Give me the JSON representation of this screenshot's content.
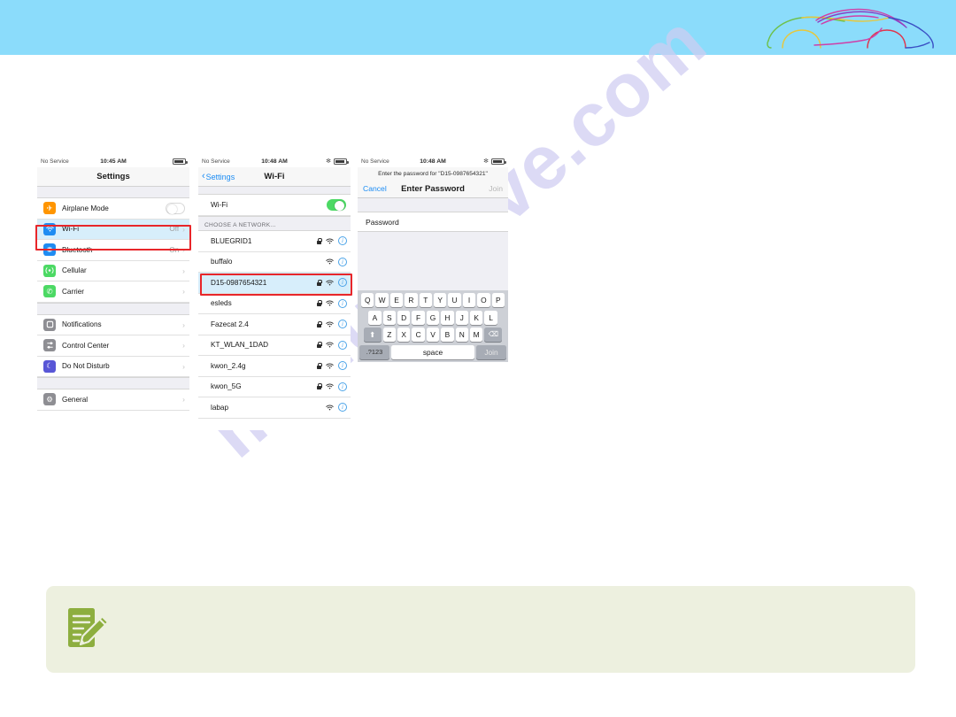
{
  "banner": {
    "logo_name": "car-outline-logo"
  },
  "watermark": {
    "text": "manualslive.com"
  },
  "phone1": {
    "statusbar": {
      "carrier": "No Service",
      "time": "10:45 AM"
    },
    "nav": {
      "title": "Settings"
    },
    "group1": [
      {
        "icon": "airplane-icon",
        "label": "Airplane Mode",
        "control": "toggle-off"
      },
      {
        "icon": "wifi-icon",
        "label": "Wi-Fi",
        "value": "Off",
        "control": "chevron",
        "selected": true
      },
      {
        "icon": "bluetooth-icon",
        "label": "Bluetooth",
        "value": "On",
        "control": "chevron"
      },
      {
        "icon": "cellular-icon",
        "label": "Cellular",
        "value": "",
        "control": "chevron"
      },
      {
        "icon": "carrier-icon",
        "label": "Carrier",
        "value": "",
        "control": "chevron"
      }
    ],
    "group2": [
      {
        "icon": "notifications-icon",
        "label": "Notifications",
        "value": "",
        "control": "chevron"
      },
      {
        "icon": "control-center-icon",
        "label": "Control Center",
        "value": "",
        "control": "chevron"
      },
      {
        "icon": "do-not-disturb-icon",
        "label": "Do Not Disturb",
        "value": "",
        "control": "chevron"
      }
    ],
    "group3": [
      {
        "icon": "general-icon",
        "label": "General",
        "value": "",
        "control": "chevron"
      }
    ]
  },
  "phone2": {
    "statusbar": {
      "carrier": "No Service",
      "time": "10:48 AM"
    },
    "nav": {
      "back": "Settings",
      "title": "Wi-Fi"
    },
    "wifi_row": {
      "label": "Wi-Fi",
      "state": "on"
    },
    "section_header": "CHOOSE A NETWORK...",
    "networks": [
      {
        "name": "BLUEGRID1",
        "locked": true,
        "selected": false
      },
      {
        "name": "buffalo",
        "locked": false,
        "selected": false
      },
      {
        "name": "D15-0987654321",
        "locked": true,
        "selected": true
      },
      {
        "name": "esleds",
        "locked": true,
        "selected": false
      },
      {
        "name": "Fazecat 2.4",
        "locked": true,
        "selected": false
      },
      {
        "name": "KT_WLAN_1DAD",
        "locked": true,
        "selected": false
      },
      {
        "name": "kwon_2.4g",
        "locked": true,
        "selected": false
      },
      {
        "name": "kwon_5G",
        "locked": true,
        "selected": false
      },
      {
        "name": "labap",
        "locked": false,
        "selected": false
      }
    ]
  },
  "phone3": {
    "statusbar": {
      "carrier": "No Service",
      "time": "10:48 AM"
    },
    "prompt": "Enter the password for \"D15-0987654321\"",
    "nav": {
      "cancel": "Cancel",
      "title": "Enter Password",
      "join": "Join"
    },
    "field": {
      "label": "Password",
      "value": "",
      "placeholder": "Password"
    },
    "keyboard": {
      "row1": [
        "Q",
        "W",
        "E",
        "R",
        "T",
        "Y",
        "U",
        "I",
        "O",
        "P"
      ],
      "row2": [
        "A",
        "S",
        "D",
        "F",
        "G",
        "H",
        "J",
        "K",
        "L"
      ],
      "row3": [
        "Z",
        "X",
        "C",
        "V",
        "B",
        "N",
        "M"
      ],
      "shift": "shift-icon",
      "delete": "delete-icon",
      "numbers": ".?123",
      "space": "space",
      "join": "Join"
    }
  },
  "note": {
    "icon": "note-pencil-icon",
    "text": ""
  },
  "colors": {
    "banner": "#8BDCFB",
    "highlight_red": "#E8262A",
    "selected_blue": "#D7EEFB",
    "toggle_green": "#4CD964",
    "link_blue": "#1b8cf4",
    "note_bg": "#EDF0DF",
    "note_green": "#8DAE3F"
  }
}
